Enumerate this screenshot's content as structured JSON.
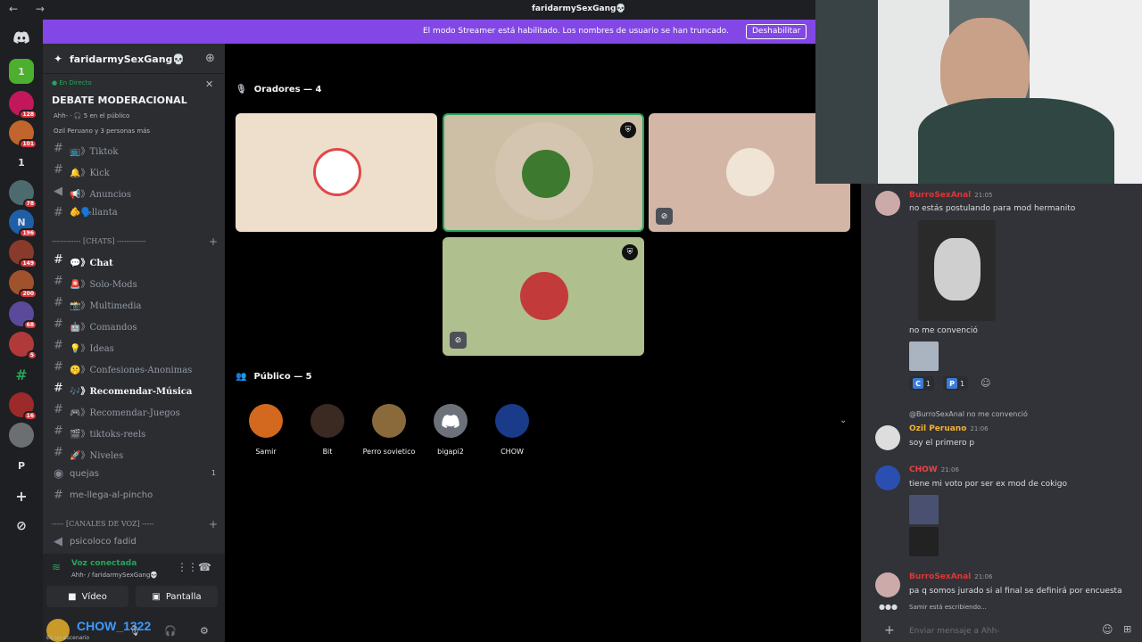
{
  "window": {
    "title": "faridarmySexGang💀",
    "nav": "← →"
  },
  "banner": {
    "message": "El modo Streamer está habilitado. Los nombres de usuario se han truncado.",
    "button": "Deshabilitar"
  },
  "servers": [
    {
      "label": "",
      "badge": ""
    },
    {
      "label": "1",
      "badge": ""
    },
    {
      "label": "",
      "badge": "128"
    },
    {
      "label": "",
      "badge": "101"
    },
    {
      "label": "1",
      "badge": ""
    },
    {
      "label": "",
      "badge": "78"
    },
    {
      "label": "N",
      "badge": "196"
    },
    {
      "label": "",
      "badge": "149"
    },
    {
      "label": "",
      "badge": "200"
    },
    {
      "label": "",
      "badge": "68"
    },
    {
      "label": "",
      "badge": "5"
    },
    {
      "label": "#",
      "badge": ""
    },
    {
      "label": "",
      "badge": "16"
    },
    {
      "label": "",
      "badge": ""
    },
    {
      "label": "P",
      "badge": ""
    },
    {
      "label": "+",
      "badge": ""
    },
    {
      "label": "⊘",
      "badge": ""
    }
  ],
  "guild": {
    "name": "faridarmySexGang💀"
  },
  "stage_event": {
    "live": "En Directo",
    "title": "DEBATE MODERACIONAL",
    "info1": "Ahh- · 🎧 5 en el público",
    "info2": "Ozil Peruano y 3 personas más"
  },
  "channels": [
    {
      "label": "📺》Tiktok",
      "unread": false,
      "count": ""
    },
    {
      "label": "🔔》Kick",
      "unread": false,
      "count": ""
    },
    {
      "label": "📢》Anuncios",
      "unread": false,
      "count": ""
    },
    {
      "label": "🫵🗣️llanta",
      "unread": false,
      "count": ""
    }
  ],
  "category_chats": "------------ [CHATS] ------------",
  "chat_channels": [
    {
      "label": "💬》Chat",
      "unread": true,
      "count": ""
    },
    {
      "label": "🚨》Solo-Mods",
      "unread": false,
      "count": ""
    },
    {
      "label": "📸》Multimedia",
      "unread": false,
      "count": ""
    },
    {
      "label": "🤖》Comandos",
      "unread": false,
      "count": ""
    },
    {
      "label": "💡》Ideas",
      "unread": false,
      "count": ""
    },
    {
      "label": "🤫》Confesiones-Anonimas",
      "unread": false,
      "count": ""
    },
    {
      "label": "🎶》Recomendar-Música",
      "unread": true,
      "count": ""
    },
    {
      "label": "🎮》Recomendar-Juegos",
      "unread": false,
      "count": ""
    },
    {
      "label": "🎬》tiktoks-reels",
      "unread": false,
      "count": ""
    },
    {
      "label": "🚀》Niveles",
      "unread": false,
      "count": ""
    },
    {
      "label": "quejas",
      "unread": false,
      "count": "1"
    },
    {
      "label": "me-llega-al-pincho",
      "unread": false,
      "count": ""
    }
  ],
  "category_voice": "----- [CANALES DE VOZ] -----",
  "voice_channel": "psicoloco fadid",
  "voice": {
    "status": "Voz conectada",
    "sub": "Ahh- / faridarmySexGang💀",
    "video": "Vídeo",
    "screen": "Pantalla"
  },
  "user": {
    "name": "CHOW_1322",
    "status": "En un escenario"
  },
  "stage": {
    "speakers_header": "Oradores — 4",
    "audience_header": "Público — 5",
    "audience": [
      "Samir",
      "Bit",
      "Perro sovietico",
      "bigapi2",
      "CHOW"
    ]
  },
  "chat": {
    "messages": [
      {
        "author": "BurroSexAnal",
        "time": "21:05",
        "text": "no estás postulando para mod hermanito"
      },
      {
        "author": "",
        "time": "",
        "text": "no me convenció"
      },
      {
        "author": "Ozil Peruano",
        "time": "21:06",
        "text": "soy el primero p",
        "reply": "@BurroSexAnal no me convenció"
      },
      {
        "author": "CHOW",
        "time": "21:06",
        "text": "tiene mi voto por ser ex mod de cokigo"
      },
      {
        "author": "BurroSexAnal",
        "time": "21:06",
        "text": "pa q somos jurado si al final se definirá por encuesta"
      }
    ],
    "reactions": [
      {
        "emoji": "C",
        "count": "1"
      },
      {
        "emoji": "P",
        "count": "1"
      }
    ],
    "typing": "Samir está escribiendo...",
    "placeholder": "Enviar mensaje a Ahh-"
  },
  "colors": {
    "accent": "#8247e5",
    "online": "#23a55a",
    "burro": "#e03535",
    "ozil": "#f0b232",
    "chow": "#ed4245"
  }
}
